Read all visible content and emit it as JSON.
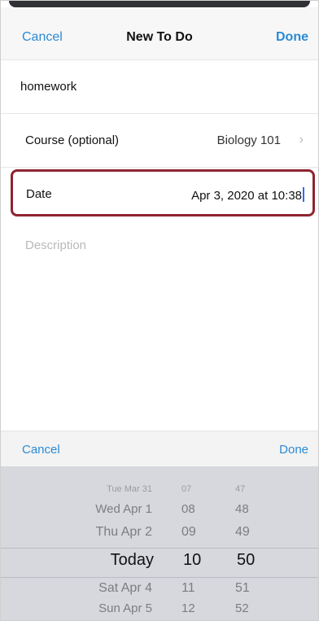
{
  "nav": {
    "cancel": "Cancel",
    "title": "New To Do",
    "done": "Done"
  },
  "form": {
    "title_value": "homework",
    "course_label": "Course (optional)",
    "course_value": "Biology 101",
    "date_label": "Date",
    "date_value": "Apr 3, 2020 at 10:38",
    "description_placeholder": "Description"
  },
  "picker_toolbar": {
    "cancel": "Cancel",
    "done": "Done"
  },
  "picker": {
    "rows": [
      {
        "day": "Tue Mar 31",
        "hour": "07",
        "minute": "47"
      },
      {
        "day": "Wed Apr 1",
        "hour": "08",
        "minute": "48"
      },
      {
        "day": "Thu Apr 2",
        "hour": "09",
        "minute": "49"
      },
      {
        "day": "Today",
        "hour": "10",
        "minute": "50"
      },
      {
        "day": "Sat Apr 4",
        "hour": "11",
        "minute": "51"
      },
      {
        "day": "Sun Apr 5",
        "hour": "12",
        "minute": "52"
      }
    ],
    "selected_index": 3
  },
  "colors": {
    "accent_blue": "#2a8bd6",
    "highlight_border": "#8f2530"
  },
  "icons": {
    "chevron": "chevron-right-icon"
  }
}
